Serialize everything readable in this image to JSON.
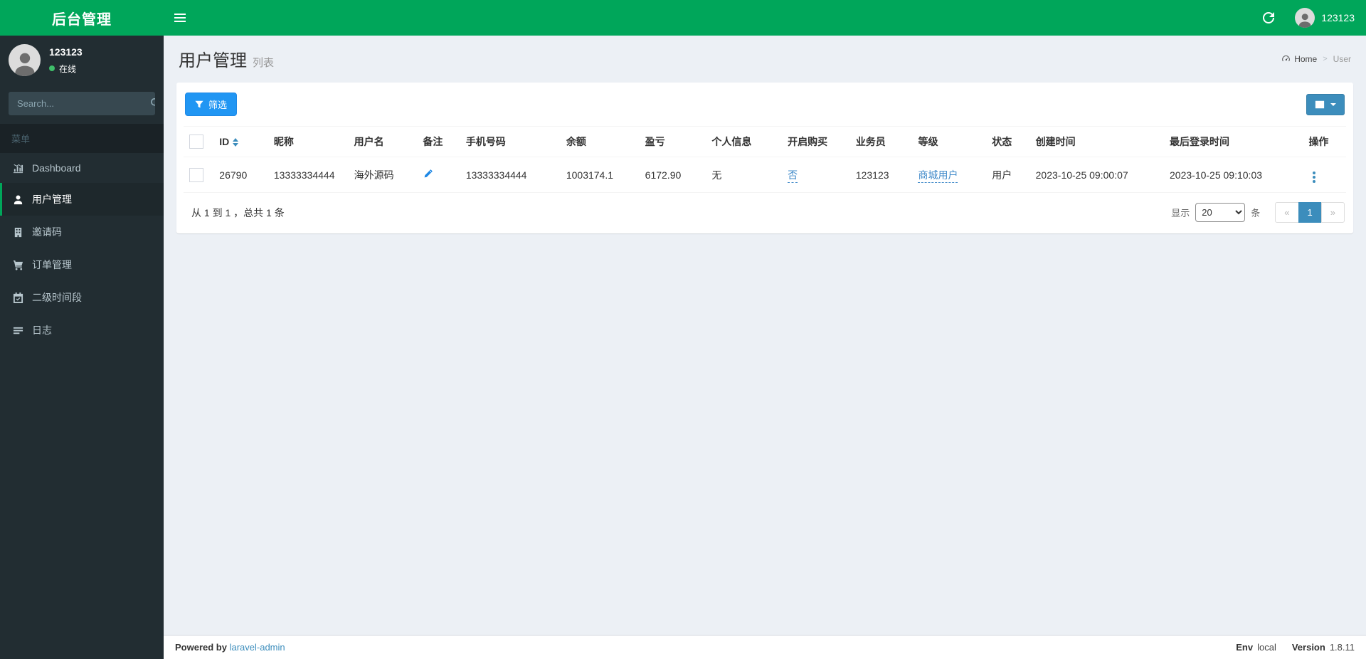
{
  "brand": {
    "title": "后台管理"
  },
  "topbar": {
    "username": "123123"
  },
  "sidebar": {
    "user": {
      "name": "123123",
      "status": "在线"
    },
    "search_placeholder": "Search...",
    "menu_header": "菜单",
    "items": [
      {
        "label": "Dashboard",
        "icon": "bar-chart-icon",
        "active": false
      },
      {
        "label": "用户管理",
        "icon": "user-icon",
        "active": true
      },
      {
        "label": "邀请码",
        "icon": "building-icon",
        "active": false
      },
      {
        "label": "订单管理",
        "icon": "cart-icon",
        "active": false
      },
      {
        "label": "二级时间段",
        "icon": "calendar-icon",
        "active": false
      },
      {
        "label": "日志",
        "icon": "log-list-icon",
        "active": false
      }
    ]
  },
  "page": {
    "title": "用户管理",
    "subtitle": "列表",
    "breadcrumb": {
      "home": "Home",
      "separator": ">",
      "current": "User"
    }
  },
  "toolbar": {
    "filter_label": "筛选"
  },
  "table": {
    "headers": [
      "ID",
      "昵称",
      "用户名",
      "备注",
      "手机号码",
      "余额",
      "盈亏",
      "个人信息",
      "开启购买",
      "业务员",
      "等级",
      "状态",
      "创建时间",
      "最后登录时间",
      "操作"
    ],
    "rows": [
      {
        "id": "26790",
        "nickname": "13333334444",
        "username": "海外源码",
        "remark_icon": "pencil-icon",
        "phone": "13333334444",
        "balance": "1003174.1",
        "profit": "6172.90",
        "personal_info": "无",
        "purchase_enabled": "否",
        "salesman": "123123",
        "level": "商城用户",
        "status": "用户",
        "created_at": "2023-10-25 09:00:07",
        "last_login_at": "2023-10-25 09:10:03"
      }
    ]
  },
  "pagination": {
    "summary": "从 1 到 1 ，总共 1 条",
    "show_label": "显示",
    "unit_label": "条",
    "per_page": "20",
    "prev": "«",
    "page": "1",
    "next": "»"
  },
  "footer": {
    "powered_by": "Powered by",
    "powered_link": "laravel-admin",
    "env_label": "Env",
    "env_value": "local",
    "version_label": "Version",
    "version_value": "1.8.11"
  },
  "colors": {
    "brand_green": "#00a65a",
    "sidebar_bg": "#222d32",
    "filter_blue": "#2196f3",
    "primary_blue": "#3c8dbc",
    "content_bg": "#ecf0f5"
  }
}
